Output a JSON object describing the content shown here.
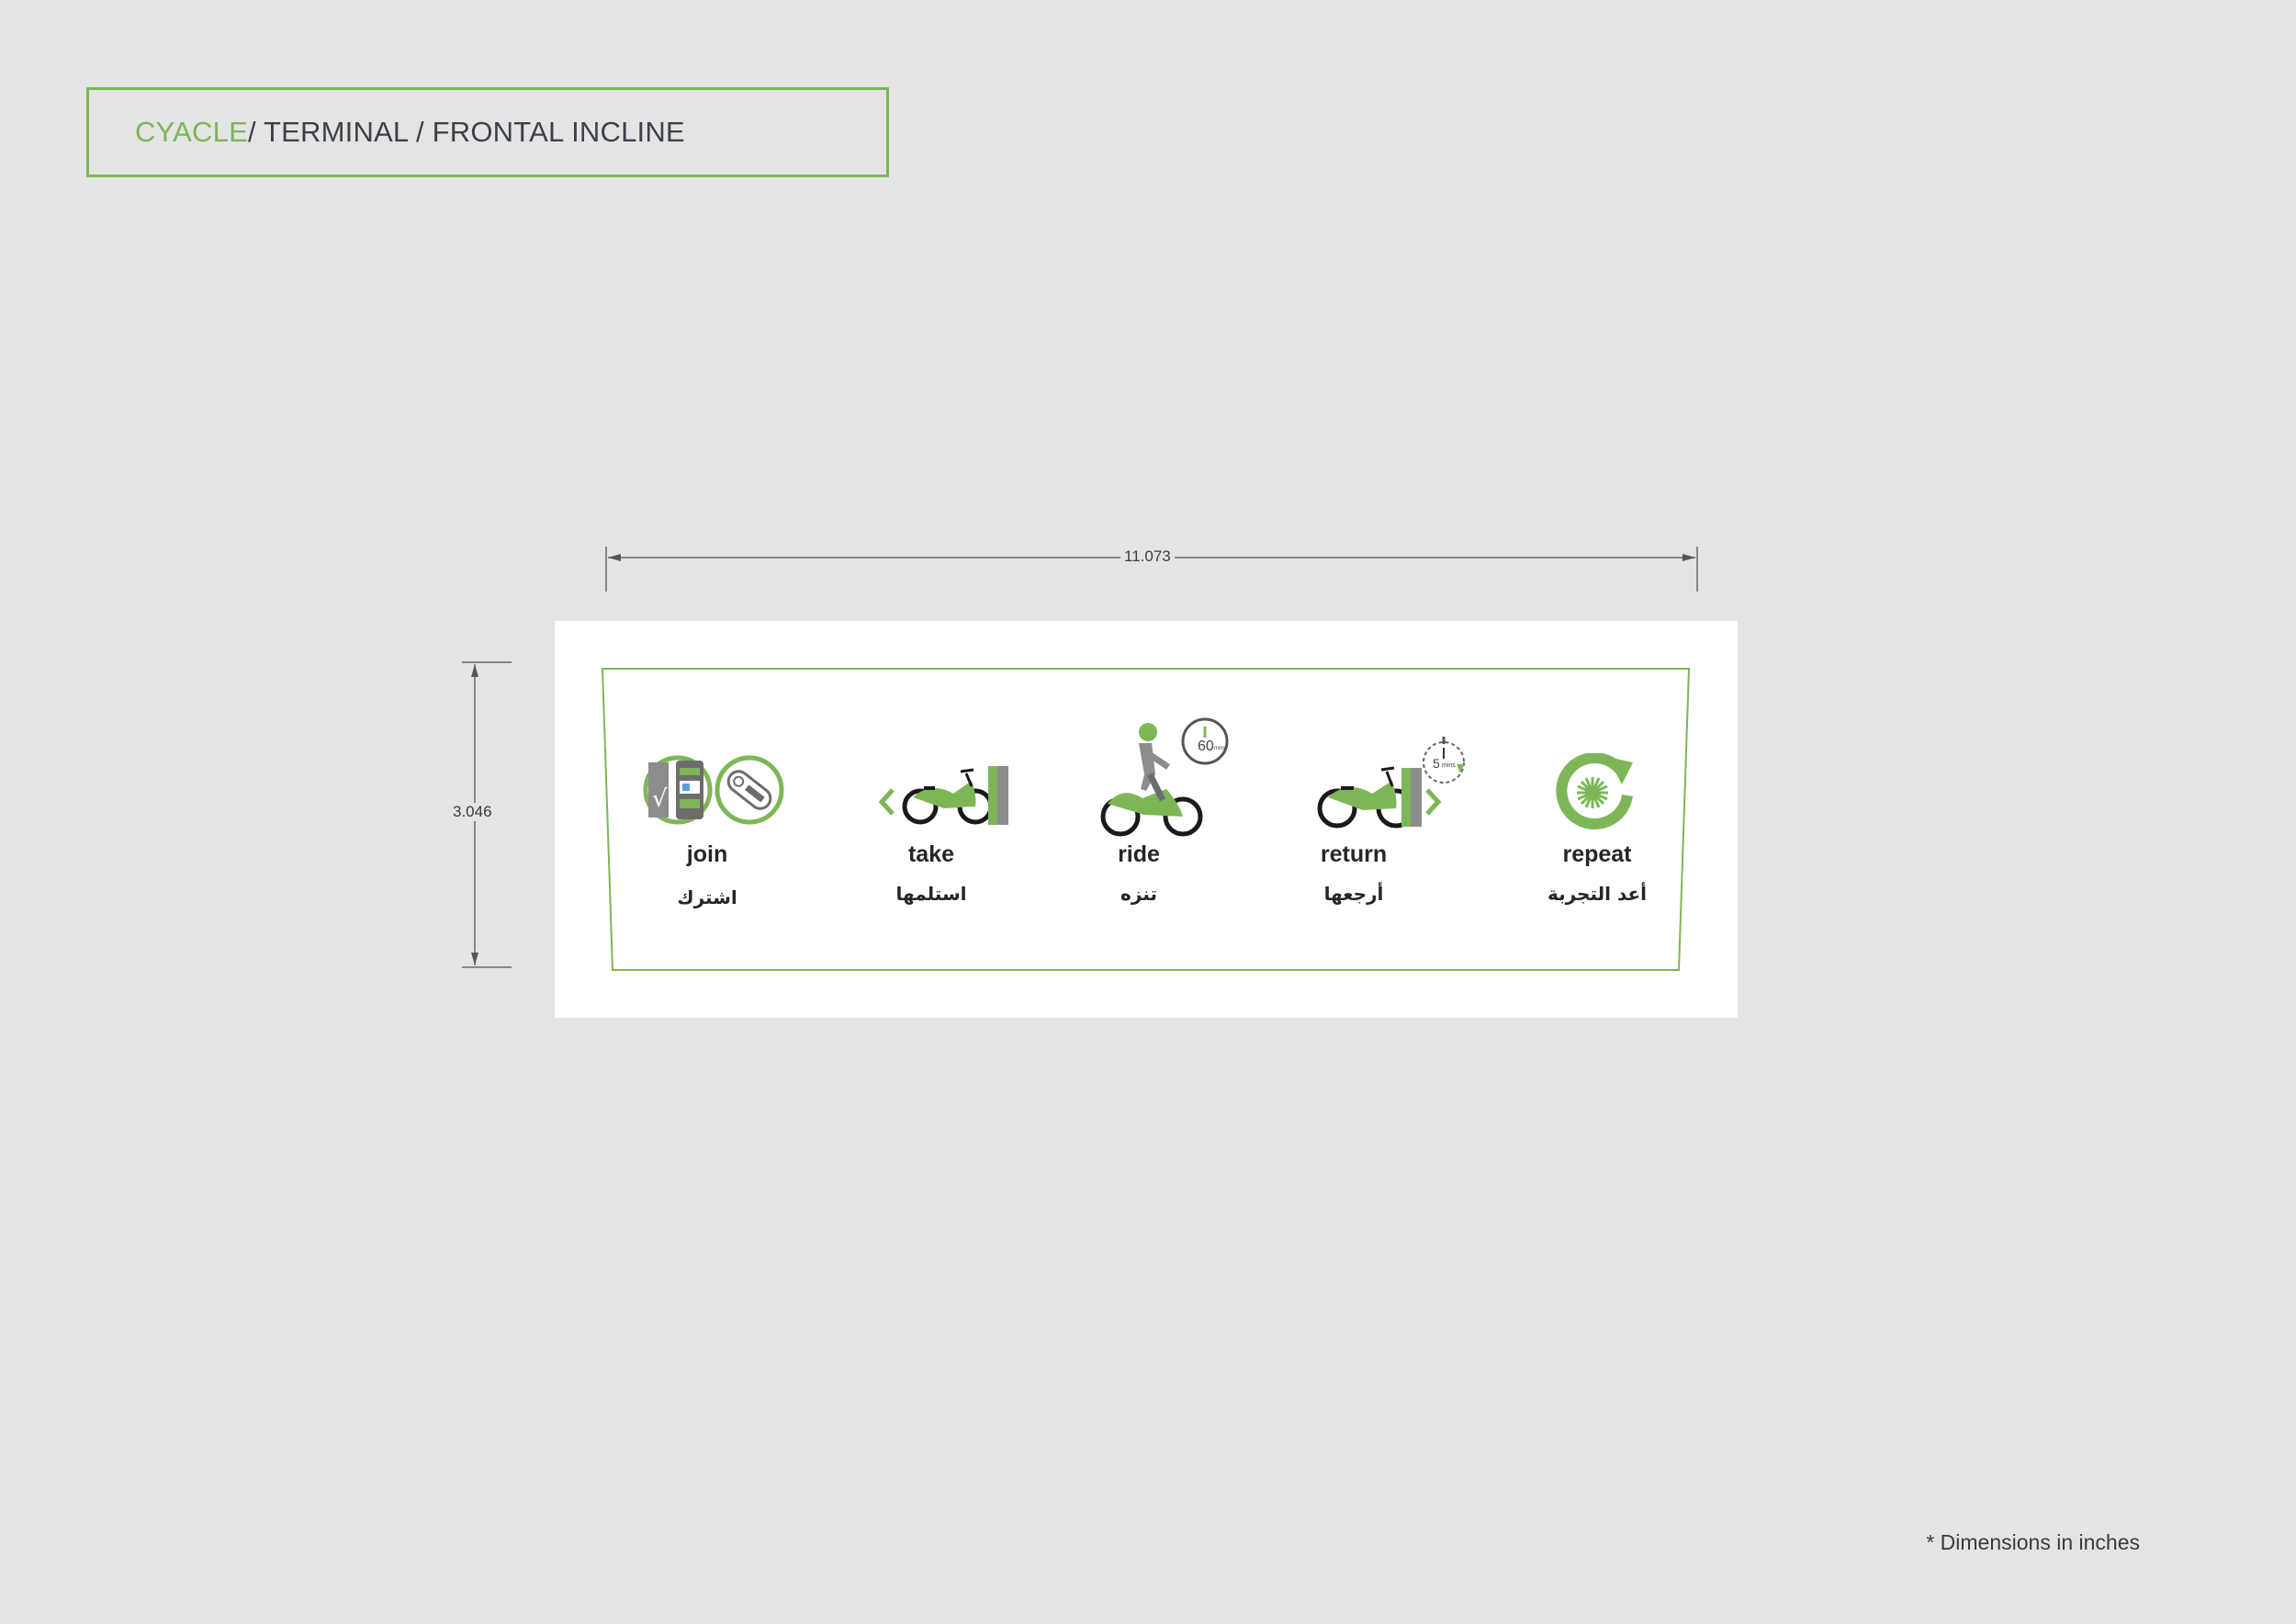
{
  "header": {
    "brand": "CYACLE",
    "path": " / TERMINAL / FRONTAL INCLINE"
  },
  "dimensions": {
    "width_label": "11.073",
    "height_label": "3.046"
  },
  "steps": [
    {
      "en": "join",
      "ar": "اشترك",
      "icon": "card-and-key-icon"
    },
    {
      "en": "take",
      "ar": "استلمها",
      "icon": "bike-take-icon"
    },
    {
      "en": "ride",
      "ar": "تنزه",
      "icon": "rider-icon",
      "badge": "60",
      "badge_unit": "mins"
    },
    {
      "en": "return",
      "ar": "أرجعها",
      "icon": "bike-return-icon",
      "badge": "5",
      "badge_unit": "mins"
    },
    {
      "en": "repeat",
      "ar": "أعد التجربة",
      "icon": "repeat-icon"
    }
  ],
  "footnote": "* Dimensions in inches",
  "colors": {
    "accent": "#7db657",
    "dark": "#262626",
    "gray": "#808080",
    "background": "#e3e4e3"
  }
}
